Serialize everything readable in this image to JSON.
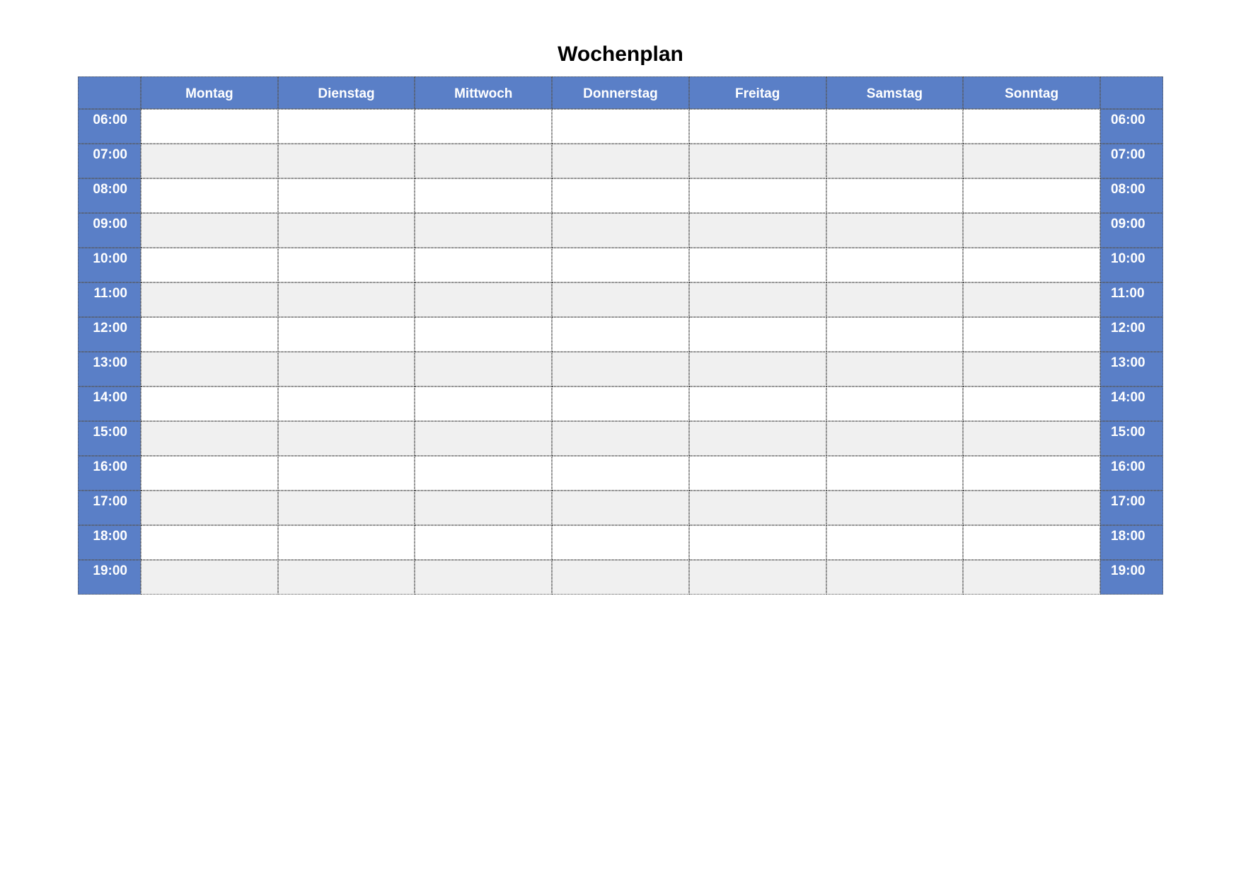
{
  "title": "Wochenplan",
  "days": [
    "Montag",
    "Dienstag",
    "Mittwoch",
    "Donnerstag",
    "Freitag",
    "Samstag",
    "Sonntag"
  ],
  "times": [
    "06:00",
    "07:00",
    "08:00",
    "09:00",
    "10:00",
    "11:00",
    "12:00",
    "13:00",
    "14:00",
    "15:00",
    "16:00",
    "17:00",
    "18:00",
    "19:00"
  ],
  "cells": [
    [
      "",
      "",
      "",
      "",
      "",
      "",
      ""
    ],
    [
      "",
      "",
      "",
      "",
      "",
      "",
      ""
    ],
    [
      "",
      "",
      "",
      "",
      "",
      "",
      ""
    ],
    [
      "",
      "",
      "",
      "",
      "",
      "",
      ""
    ],
    [
      "",
      "",
      "",
      "",
      "",
      "",
      ""
    ],
    [
      "",
      "",
      "",
      "",
      "",
      "",
      ""
    ],
    [
      "",
      "",
      "",
      "",
      "",
      "",
      ""
    ],
    [
      "",
      "",
      "",
      "",
      "",
      "",
      ""
    ],
    [
      "",
      "",
      "",
      "",
      "",
      "",
      ""
    ],
    [
      "",
      "",
      "",
      "",
      "",
      "",
      ""
    ],
    [
      "",
      "",
      "",
      "",
      "",
      "",
      ""
    ],
    [
      "",
      "",
      "",
      "",
      "",
      "",
      ""
    ],
    [
      "",
      "",
      "",
      "",
      "",
      "",
      ""
    ],
    [
      "",
      "",
      "",
      "",
      "",
      "",
      ""
    ]
  ],
  "colors": {
    "accent": "#5a7fc7",
    "altRow": "#f0f0f0"
  }
}
